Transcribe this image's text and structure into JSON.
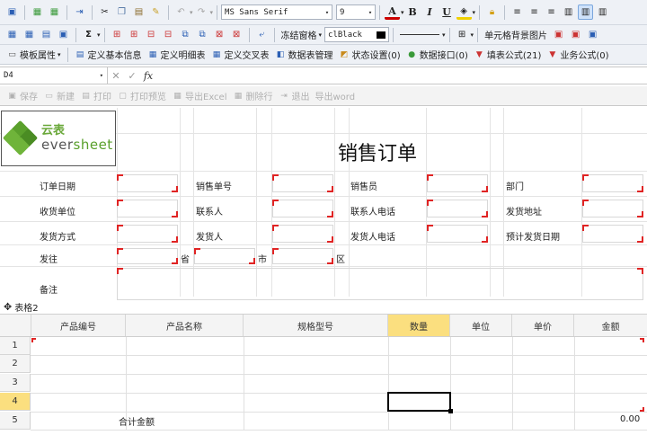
{
  "toolbar1": {
    "font_name": "MS Sans Serif",
    "font_size": "9",
    "bold": "B",
    "italic": "I",
    "underline": "U",
    "color_letter": "A"
  },
  "toolbar2": {
    "freeze_label": "冻结窗格",
    "color_value": "clBlack",
    "cell_bg_image_label": "单元格背景图片",
    "sum_symbol": "Σ"
  },
  "toolbar3": {
    "items": [
      {
        "label": "模板属性",
        "icon": "template-icon"
      },
      {
        "label": "定义基本信息",
        "icon": "info-icon"
      },
      {
        "label": "定义明细表",
        "icon": "detail-table-icon"
      },
      {
        "label": "定义交叉表",
        "icon": "cross-table-icon"
      },
      {
        "label": "数据表管理",
        "icon": "datatable-icon"
      },
      {
        "label": "状态设置(0)",
        "icon": "status-icon"
      },
      {
        "label": "数据接口(0)",
        "icon": "interface-icon"
      },
      {
        "label": "填表公式(21)",
        "icon": "fill-formula-icon"
      },
      {
        "label": "业务公式(0)",
        "icon": "biz-formula-icon"
      }
    ]
  },
  "formula_bar": {
    "cell_ref": "D4",
    "fx": "fx",
    "value": ""
  },
  "toolbar4": {
    "items": [
      {
        "label": "保存",
        "icon": "save-icon"
      },
      {
        "label": "新建",
        "icon": "new-icon"
      },
      {
        "label": "打印",
        "icon": "print-icon"
      },
      {
        "label": "打印预览",
        "icon": "preview-icon"
      },
      {
        "label": "导出Excel",
        "icon": "excel-icon"
      },
      {
        "label": "删除行",
        "icon": "delete-row-icon"
      },
      {
        "label": "退出",
        "icon": "exit-icon"
      },
      {
        "label": "导出word",
        "icon": "word-icon"
      }
    ]
  },
  "logo": {
    "cn": "云表",
    "en_prefix": "ever",
    "en_suffix": "sheet"
  },
  "form": {
    "title": "销售订单",
    "labels": {
      "order_date": "订单日期",
      "order_no": "销售单号",
      "salesperson": "销售员",
      "department": "部门",
      "receiver": "收货单位",
      "contact": "联系人",
      "contact_phone": "联系人电话",
      "ship_address": "发货地址",
      "ship_method": "发货方式",
      "shipper": "发货人",
      "shipper_phone": "发货人电话",
      "ship_date": "预计发货日期",
      "ship_to": "发往",
      "province": "省",
      "city": "市",
      "district": "区",
      "remark": "备注"
    }
  },
  "detail_table": {
    "tag": "表格2",
    "headers": [
      "产品编号",
      "产品名称",
      "规格型号",
      "数量",
      "单位",
      "单价",
      "金额"
    ],
    "row_numbers": [
      "1",
      "2",
      "3",
      "4",
      "5"
    ],
    "total_label": "合计金额",
    "total_value": "0.00"
  },
  "colors": {
    "selected_header": "#fbdf7f",
    "field_marker": "#e02424",
    "brand_green": "#5aa02c"
  }
}
